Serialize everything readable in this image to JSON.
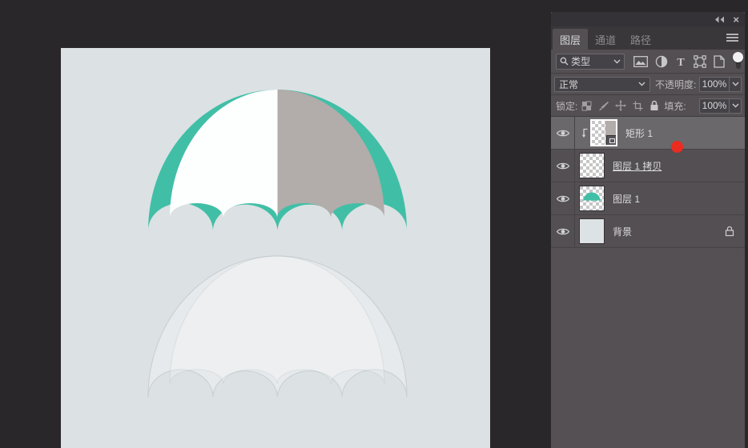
{
  "panel_header": {
    "close_label": "×"
  },
  "tabs": {
    "layers": "图层",
    "channels": "通道",
    "paths": "路径"
  },
  "filter": {
    "type_label": "类型",
    "text_filter_glyph": "T"
  },
  "blend": {
    "mode": "正常",
    "opacity_label": "不透明度:",
    "opacity_value": "100%"
  },
  "lock": {
    "lock_label": "锁定:",
    "fill_label": "填充:",
    "fill_value": "100%"
  },
  "layers_list": [
    {
      "name": "矩形 1",
      "selected": true,
      "clipped": true
    },
    {
      "name": "图层 1 拷贝",
      "renaming": true
    },
    {
      "name": "图层 1"
    },
    {
      "name": "背景",
      "locked": true
    }
  ],
  "colors": {
    "workspace_bg": "#2a272b",
    "canvas_bg": "#dce1e4",
    "umbrella_teal": "#41bfa6",
    "umbrella_gray": "#b2acaa",
    "umbrella_white": "#fdfefe",
    "panel_bg": "#534f53",
    "selected_row_bg": "#6b686b",
    "red_dot": "#ea2c21"
  }
}
